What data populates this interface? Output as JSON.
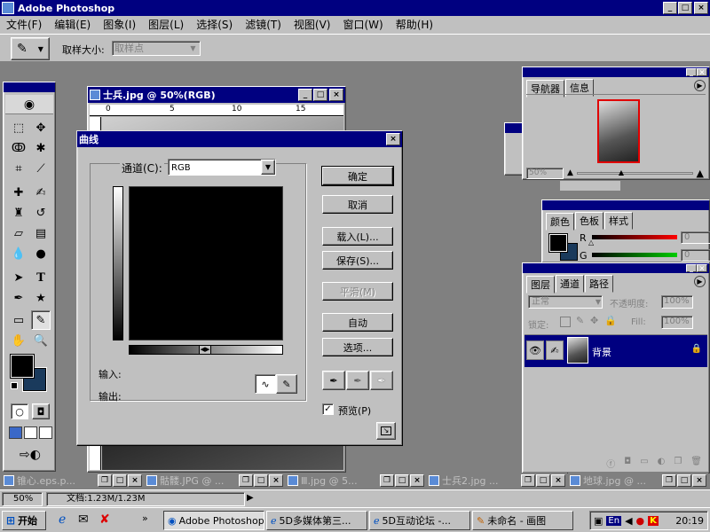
{
  "app": {
    "title": "Adobe Photoshop",
    "win_min": "_",
    "win_max": "□",
    "win_close": "×"
  },
  "menu": [
    "文件(F)",
    "编辑(E)",
    "图象(I)",
    "图层(L)",
    "选择(S)",
    "滤镜(T)",
    "视图(V)",
    "窗口(W)",
    "帮助(H)"
  ],
  "options": {
    "sample_label": "取样大小:",
    "sample_value": "取样点"
  },
  "image_window": {
    "title": "士兵.jpg @ 50%(RGB)",
    "ruler": [
      "0",
      "5",
      "10",
      "15"
    ]
  },
  "curves": {
    "title": "曲线",
    "channel_label": "通道(C):",
    "channel_value": "RGB",
    "input_label": "输入:",
    "output_label": "输出:",
    "buttons": {
      "ok": "确定",
      "cancel": "取消",
      "load": "载入(L)...",
      "save": "保存(S)...",
      "smooth": "平滑(M)",
      "auto": "自动",
      "options": "选项..."
    },
    "preview_label": "预览(P)",
    "close": "×"
  },
  "navigator": {
    "tabs": [
      "导航器",
      "信息"
    ],
    "zoom": "50%"
  },
  "color_panel": {
    "tabs": [
      "颜色",
      "色板",
      "样式"
    ],
    "r_label": "R",
    "g_label": "G",
    "r_value": "0",
    "g_value": "0"
  },
  "layers": {
    "tabs": [
      "图层",
      "通道",
      "路径"
    ],
    "mode": "正常",
    "opacity_label": "不透明度:",
    "opacity_value": "100%",
    "lock_label": "锁定:",
    "fill_label": "Fill:",
    "fill_value": "100%",
    "layer_name": "背景"
  },
  "docs": [
    "锥心.eps.p...",
    "骷髅.JPG @ ...",
    "Ⅲ.jpg @ 5...",
    "士兵2.jpg ...",
    "地球.jpg @ ..."
  ],
  "status": {
    "zoom": "50%",
    "doc": "文档:1.23M/1.23M"
  },
  "taskbar": {
    "start": "开始",
    "items": [
      "Adobe Photoshop",
      "5D多媒体第三...",
      "5D互动论坛 -...",
      "未命名 - 画图"
    ],
    "tray_lang": "En",
    "clock": "20:19"
  },
  "colors": {
    "title_active": "#000080",
    "face": "#c0c0c0",
    "desktop": "#808080",
    "bg_swatch": "#1a3a5c"
  }
}
